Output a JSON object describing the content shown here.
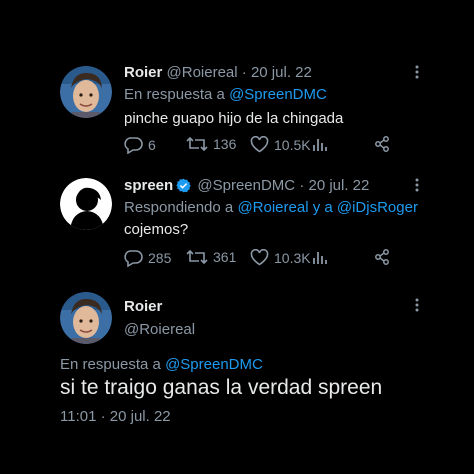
{
  "tweets": [
    {
      "name": "Roier",
      "handle": "@Roiereal",
      "separator": "·",
      "date": "20 jul. 22",
      "reply_prefix": "En respuesta a",
      "reply_to": "@SpreenDMC",
      "text": "pinche guapo hijo de la chingada",
      "replies": "6",
      "retweets": "136",
      "likes": "10.5K",
      "avatar_icon": "avatar-photo-roier"
    },
    {
      "name": "spreen",
      "verified": true,
      "handle": "@SpreenDMC",
      "separator": "·",
      "date": "20 jul. 22",
      "reply_prefix": "Respondiendo a",
      "reply_to": "@Roiereal y a @iDjsRoger",
      "text": "cojemos?",
      "replies": "285",
      "retweets": "361",
      "likes": "10.3K",
      "avatar_icon": "avatar-silhouette-spreen"
    },
    {
      "name": "Roier",
      "handle": "@Roiereal",
      "reply_prefix": "En respuesta a",
      "reply_to": "@SpreenDMC",
      "text": "si te traigo ganas la verdad spreen",
      "timestamp": "11:01 · 20 jul. 22",
      "avatar_icon": "avatar-photo-roier"
    }
  ],
  "colors": {
    "background": "#000000",
    "text": "#e7e9ea",
    "muted": "#8b98a5",
    "link": "#1d9bf0",
    "verified": "#1d9bf0"
  }
}
